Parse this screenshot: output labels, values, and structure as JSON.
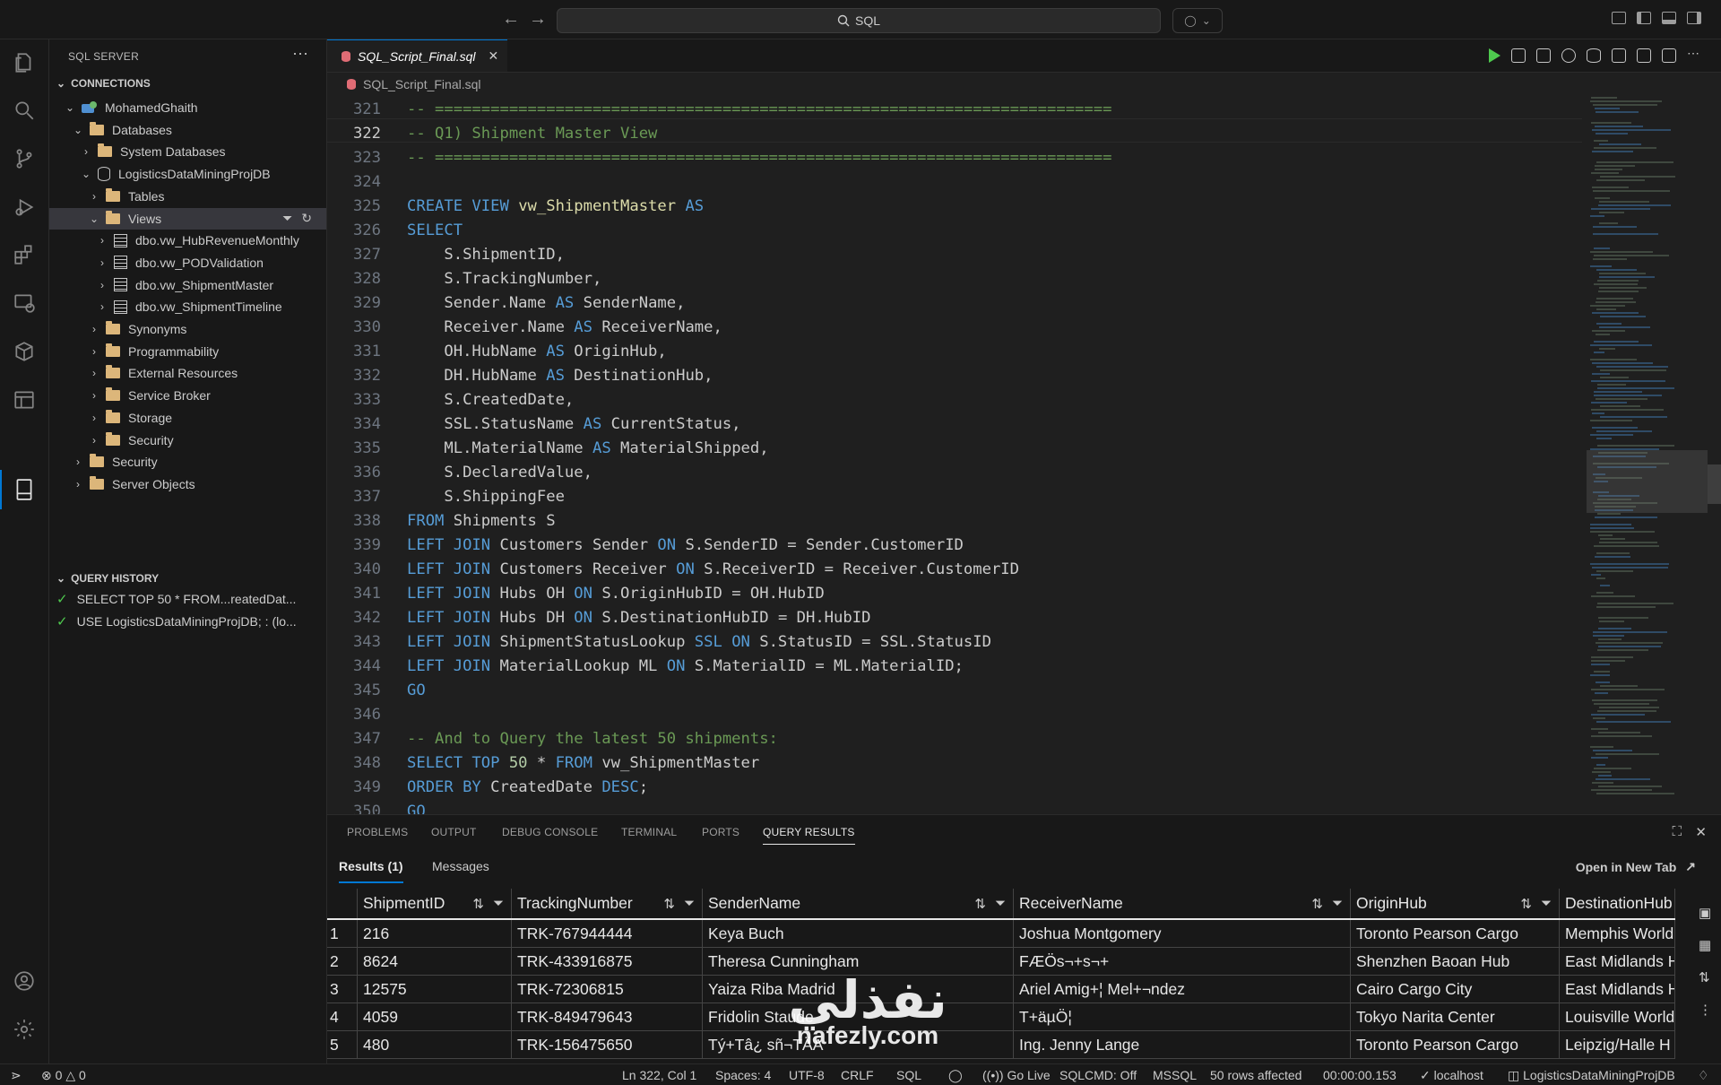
{
  "titlebar": {
    "search_text": "SQL",
    "back_icon": "arrow-left-icon",
    "forward_icon": "arrow-right-icon"
  },
  "activity_bar": {
    "items": [
      "explorer-icon",
      "search-icon",
      "source-control-icon",
      "run-debug-icon",
      "extensions-icon",
      "remote-explorer-icon",
      "packages-icon",
      "database-icon",
      "sql-server-icon",
      "account-icon",
      "settings-gear-icon"
    ],
    "active": "sql-server-icon"
  },
  "sidebar": {
    "title": "SQL SERVER",
    "connections_header": "CONNECTIONS",
    "tree": [
      {
        "label": "MohamedGhaith",
        "indent": 0,
        "icon": "server",
        "chev": "down"
      },
      {
        "label": "Databases",
        "indent": 1,
        "icon": "folder",
        "chev": "down"
      },
      {
        "label": "System Databases",
        "indent": 2,
        "icon": "folder",
        "chev": "right"
      },
      {
        "label": "LogisticsDataMiningProjDB",
        "indent": 2,
        "icon": "db",
        "chev": "down"
      },
      {
        "label": "Tables",
        "indent": 3,
        "icon": "folder",
        "chev": "right"
      },
      {
        "label": "Views",
        "indent": 3,
        "icon": "folder",
        "chev": "down",
        "selected": true
      },
      {
        "label": "dbo.vw_HubRevenueMonthly",
        "indent": 4,
        "icon": "view",
        "chev": "right"
      },
      {
        "label": "dbo.vw_PODValidation",
        "indent": 4,
        "icon": "view",
        "chev": "right"
      },
      {
        "label": "dbo.vw_ShipmentMaster",
        "indent": 4,
        "icon": "view",
        "chev": "right"
      },
      {
        "label": "dbo.vw_ShipmentTimeline",
        "indent": 4,
        "icon": "view",
        "chev": "right"
      },
      {
        "label": "Synonyms",
        "indent": 3,
        "icon": "folder",
        "chev": "right"
      },
      {
        "label": "Programmability",
        "indent": 3,
        "icon": "folder",
        "chev": "right"
      },
      {
        "label": "External Resources",
        "indent": 3,
        "icon": "folder",
        "chev": "right"
      },
      {
        "label": "Service Broker",
        "indent": 3,
        "icon": "folder",
        "chev": "right"
      },
      {
        "label": "Storage",
        "indent": 3,
        "icon": "folder",
        "chev": "right"
      },
      {
        "label": "Security",
        "indent": 3,
        "icon": "folder",
        "chev": "right"
      },
      {
        "label": "Security",
        "indent": 1,
        "icon": "folder",
        "chev": "right"
      },
      {
        "label": "Server Objects",
        "indent": 1,
        "icon": "folder",
        "chev": "right"
      }
    ],
    "history_header": "QUERY HISTORY",
    "history": [
      "SELECT TOP 50 * FROM...reatedDat...",
      "USE LogisticsDataMiningProjDB; : (lo..."
    ]
  },
  "editor": {
    "tab_label": "SQL_Script_Final.sql",
    "breadcrumb": "SQL_Script_Final.sql",
    "current_line": 322,
    "lines": [
      {
        "n": "321",
        "t": [
          [
            "c",
            "-- ========================================================================="
          ]
        ]
      },
      {
        "n": "322",
        "t": [
          [
            "c",
            "-- Q1) Shipment Master View"
          ]
        ]
      },
      {
        "n": "323",
        "t": [
          [
            "c",
            "-- ========================================================================="
          ]
        ]
      },
      {
        "n": "324",
        "t": []
      },
      {
        "n": "325",
        "t": [
          [
            "k",
            "CREATE VIEW "
          ],
          [
            "f",
            "vw_ShipmentMaster"
          ],
          [
            "k",
            " AS"
          ]
        ]
      },
      {
        "n": "326",
        "t": [
          [
            "k",
            "SELECT"
          ]
        ]
      },
      {
        "n": "327",
        "t": [
          [
            "i",
            "    S.ShipmentID,"
          ]
        ]
      },
      {
        "n": "328",
        "t": [
          [
            "i",
            "    S.TrackingNumber,"
          ]
        ]
      },
      {
        "n": "329",
        "t": [
          [
            "i",
            "    Sender.Name "
          ],
          [
            "k",
            "AS"
          ],
          [
            "i",
            " SenderName,"
          ]
        ]
      },
      {
        "n": "330",
        "t": [
          [
            "i",
            "    Receiver.Name "
          ],
          [
            "k",
            "AS"
          ],
          [
            "i",
            " ReceiverName,"
          ]
        ]
      },
      {
        "n": "331",
        "t": [
          [
            "i",
            "    OH.HubName "
          ],
          [
            "k",
            "AS"
          ],
          [
            "i",
            " OriginHub,"
          ]
        ]
      },
      {
        "n": "332",
        "t": [
          [
            "i",
            "    DH.HubName "
          ],
          [
            "k",
            "AS"
          ],
          [
            "i",
            " DestinationHub,"
          ]
        ]
      },
      {
        "n": "333",
        "t": [
          [
            "i",
            "    S.CreatedDate,"
          ]
        ]
      },
      {
        "n": "334",
        "t": [
          [
            "i",
            "    SSL.StatusName "
          ],
          [
            "k",
            "AS"
          ],
          [
            "i",
            " CurrentStatus,"
          ]
        ]
      },
      {
        "n": "335",
        "t": [
          [
            "i",
            "    ML.MaterialName "
          ],
          [
            "k",
            "AS"
          ],
          [
            "i",
            " MaterialShipped,"
          ]
        ]
      },
      {
        "n": "336",
        "t": [
          [
            "i",
            "    S.DeclaredValue,"
          ]
        ]
      },
      {
        "n": "337",
        "t": [
          [
            "i",
            "    S.ShippingFee"
          ]
        ]
      },
      {
        "n": "338",
        "t": [
          [
            "k",
            "FROM"
          ],
          [
            "i",
            " Shipments S"
          ]
        ]
      },
      {
        "n": "339",
        "t": [
          [
            "k",
            "LEFT JOIN"
          ],
          [
            "i",
            " Customers Sender "
          ],
          [
            "k",
            "ON"
          ],
          [
            "i",
            " S.SenderID = Sender.CustomerID"
          ]
        ]
      },
      {
        "n": "340",
        "t": [
          [
            "k",
            "LEFT JOIN"
          ],
          [
            "i",
            " Customers Receiver "
          ],
          [
            "k",
            "ON"
          ],
          [
            "i",
            " S.ReceiverID = Receiver.CustomerID"
          ]
        ]
      },
      {
        "n": "341",
        "t": [
          [
            "k",
            "LEFT JOIN"
          ],
          [
            "i",
            " Hubs OH "
          ],
          [
            "k",
            "ON"
          ],
          [
            "i",
            " S.OriginHubID = OH.HubID"
          ]
        ]
      },
      {
        "n": "342",
        "t": [
          [
            "k",
            "LEFT JOIN"
          ],
          [
            "i",
            " Hubs DH "
          ],
          [
            "k",
            "ON"
          ],
          [
            "i",
            " S.DestinationHubID = DH.HubID"
          ]
        ]
      },
      {
        "n": "343",
        "t": [
          [
            "k",
            "LEFT JOIN"
          ],
          [
            "i",
            " ShipmentStatusLookup "
          ],
          [
            "k",
            "SSL ON"
          ],
          [
            "i",
            " S.StatusID = SSL.StatusID"
          ]
        ]
      },
      {
        "n": "344",
        "t": [
          [
            "k",
            "LEFT JOIN"
          ],
          [
            "i",
            " MaterialLookup ML "
          ],
          [
            "k",
            "ON"
          ],
          [
            "i",
            " S.MaterialID = ML.MaterialID;"
          ]
        ]
      },
      {
        "n": "345",
        "t": [
          [
            "k",
            "GO"
          ]
        ]
      },
      {
        "n": "346",
        "t": []
      },
      {
        "n": "347",
        "t": [
          [
            "c",
            "-- And to Query the latest 50 shipments:"
          ]
        ]
      },
      {
        "n": "348",
        "t": [
          [
            "k",
            "SELECT TOP "
          ],
          [
            "n",
            "50"
          ],
          [
            "i",
            " * "
          ],
          [
            "k",
            "FROM"
          ],
          [
            "i",
            " vw_ShipmentMaster"
          ]
        ]
      },
      {
        "n": "349",
        "t": [
          [
            "k",
            "ORDER BY"
          ],
          [
            "i",
            " CreatedDate "
          ],
          [
            "k",
            "DESC"
          ],
          [
            "i",
            ";"
          ]
        ]
      },
      {
        "n": "350",
        "t": [
          [
            "k",
            "GO"
          ]
        ]
      }
    ]
  },
  "panel": {
    "tabs": [
      "PROBLEMS",
      "OUTPUT",
      "DEBUG CONSOLE",
      "TERMINAL",
      "PORTS",
      "QUERY RESULTS"
    ],
    "active_tab": "QUERY RESULTS",
    "results_tab": "Results (1)",
    "messages_tab": "Messages",
    "open_new_tab": "Open in New Tab",
    "columns": [
      "ShipmentID",
      "TrackingNumber",
      "SenderName",
      "ReceiverName",
      "OriginHub",
      "DestinationHub"
    ],
    "rows": [
      [
        "1",
        "216",
        "TRK-767944444",
        "Keya Buch",
        "Joshua Montgomery",
        "Toronto Pearson Cargo",
        "Memphis World"
      ],
      [
        "2",
        "8624",
        "TRK-433916875",
        "Theresa Cunningham",
        "FÆÖs¬+s¬+",
        "Shenzhen Baoan Hub",
        "East Midlands H"
      ],
      [
        "3",
        "12575",
        "TRK-72306815",
        "Yaiza Riba Madrid",
        "Ariel Amig+¦ Mel+¬ndez",
        "Cairo Cargo City",
        "East Midlands H"
      ],
      [
        "4",
        "4059",
        "TRK-849479643",
        "Fridolin Staude",
        "T+äµÖ¦",
        "Tokyo Narita Center",
        "Louisville World"
      ],
      [
        "5",
        "480",
        "TRK-156475650",
        "Tý+Tâ¿ sñ¬TÄA",
        "Ing. Jenny Lange",
        "Toronto Pearson Cargo",
        "Leipzig/Halle H"
      ]
    ]
  },
  "status": {
    "errors": "0",
    "warnings": "0",
    "position": "Ln 322, Col 1",
    "spaces": "Spaces: 4",
    "encoding": "UTF-8",
    "eol": "CRLF",
    "language": "SQL",
    "go_live": "Go Live",
    "sqlcmd": "SQLCMD: Off",
    "dialect": "MSSQL",
    "rows_affected": "50 rows affected",
    "elapsed": "00:00:00.153",
    "server": "localhost",
    "database": "LogisticsDataMiningProjDB"
  },
  "watermark": {
    "arabic": "نفذلي",
    "latin": "nafezly.com"
  },
  "colors": {
    "accent": "#0078d4",
    "keyword": "#569cd6",
    "comment": "#6a9955",
    "folder": "#dcb67a",
    "success": "#4ec94e"
  }
}
